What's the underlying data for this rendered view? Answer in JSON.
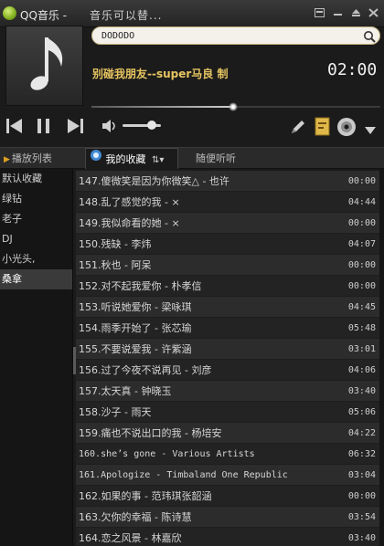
{
  "window": {
    "app_title": "QQ音乐 -",
    "marquee": "音乐可以替...",
    "controls": {
      "skin_icon": "skin-icon",
      "mini_icon": "mini-mode-icon",
      "minimize_icon": "minimize-icon",
      "close_icon": "close-icon"
    }
  },
  "player": {
    "search_value": "DODODO",
    "now_playing": "别碰我朋友--super马良 制",
    "time": "02:00",
    "progress": 0.49,
    "volume": 0.75
  },
  "tabs": [
    {
      "label": "播放列表",
      "active": false
    },
    {
      "label": "我的收藏",
      "active": true
    },
    {
      "label": "随便听听",
      "active": false
    }
  ],
  "sidebar": {
    "items": [
      "默认收藏",
      "绿钻",
      "老子",
      "DJ",
      "小光头,",
      "桑拿"
    ],
    "selected_index": 5
  },
  "songs": [
    {
      "name": "147.傻微笑是因为你微笑△ - 也许",
      "duration": "00:00"
    },
    {
      "name": "148.乱了感觉的我 - ×",
      "duration": "04:44"
    },
    {
      "name": "149.我似命看的她 - ×",
      "duration": "00:00"
    },
    {
      "name": "150.残缺 - 李炜",
      "duration": "04:07"
    },
    {
      "name": "151.秋也 - 阿呆",
      "duration": "00:00"
    },
    {
      "name": "152.对不起我爱你 - 朴孝信",
      "duration": "00:00"
    },
    {
      "name": "153.听说她爱你 - 梁咏琪",
      "duration": "04:45"
    },
    {
      "name": "154.雨季开始了 - 张芯瑜",
      "duration": "05:48"
    },
    {
      "name": "155.不要说爱我 - 许紫涵",
      "duration": "03:01"
    },
    {
      "name": "156.过了今夜不说再见 - 刘彦",
      "duration": "04:06"
    },
    {
      "name": "157.太天真 - 钟晓玉",
      "duration": "03:40"
    },
    {
      "name": "158.沙子 - 雨天",
      "duration": "05:06"
    },
    {
      "name": "159.痛也不说出口的我 - 杨培安",
      "duration": "04:22"
    },
    {
      "name": "160.she’s gone - Various Artists",
      "duration": "06:32"
    },
    {
      "name": "161.Apologize - Timbaland One Republic",
      "duration": "03:04"
    },
    {
      "name": "162.如果的事 - 范玮琪张韶涵",
      "duration": "00:00"
    },
    {
      "name": "163.欠你的幸福 - 陈诗慧",
      "duration": "03:54"
    },
    {
      "name": "164.恋之风景 - 林嘉欣",
      "duration": "03:40"
    }
  ]
}
